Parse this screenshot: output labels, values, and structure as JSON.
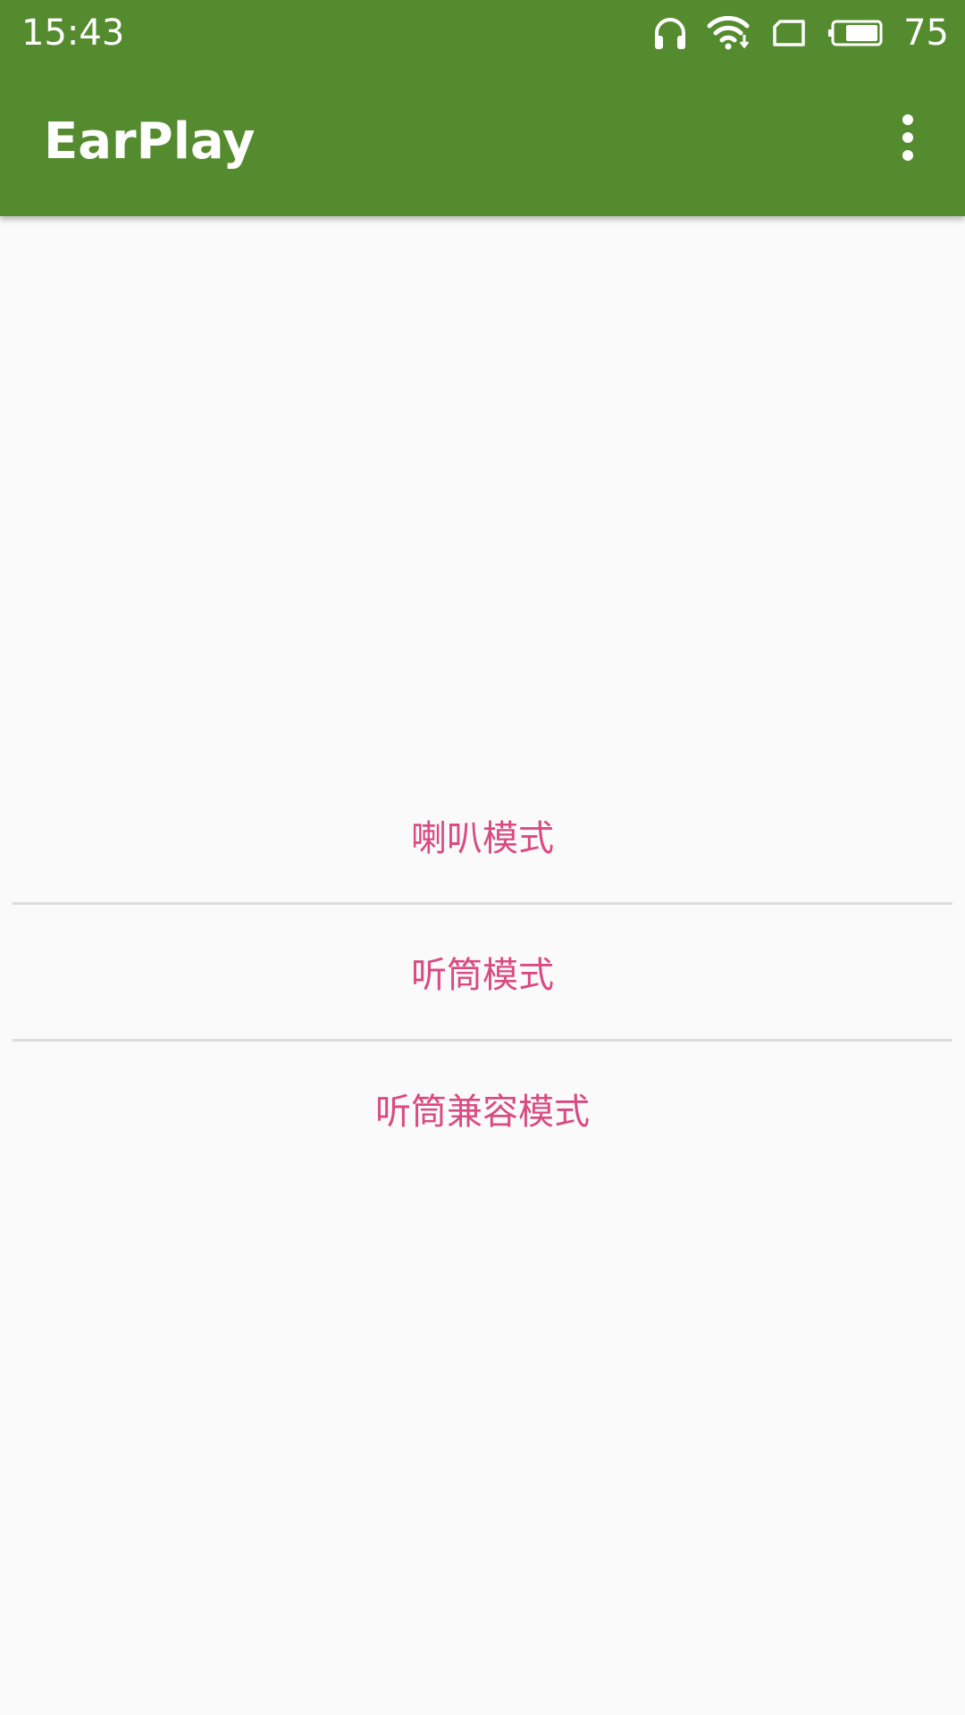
{
  "status_bar": {
    "time": "15:43",
    "battery_level": "75",
    "icons": [
      "headphones-icon",
      "wifi-icon",
      "sim-card-icon",
      "battery-icon"
    ]
  },
  "app_bar": {
    "title": "EarPlay",
    "menu_icon": "more-vert-icon"
  },
  "colors": {
    "primary": "#558b2f",
    "accent_text": "#d94b82",
    "background": "#fafafa",
    "divider": "#dcdcdc"
  },
  "modes": [
    {
      "label": "喇叭模式"
    },
    {
      "label": "听筒模式"
    },
    {
      "label": "听筒兼容模式"
    }
  ]
}
